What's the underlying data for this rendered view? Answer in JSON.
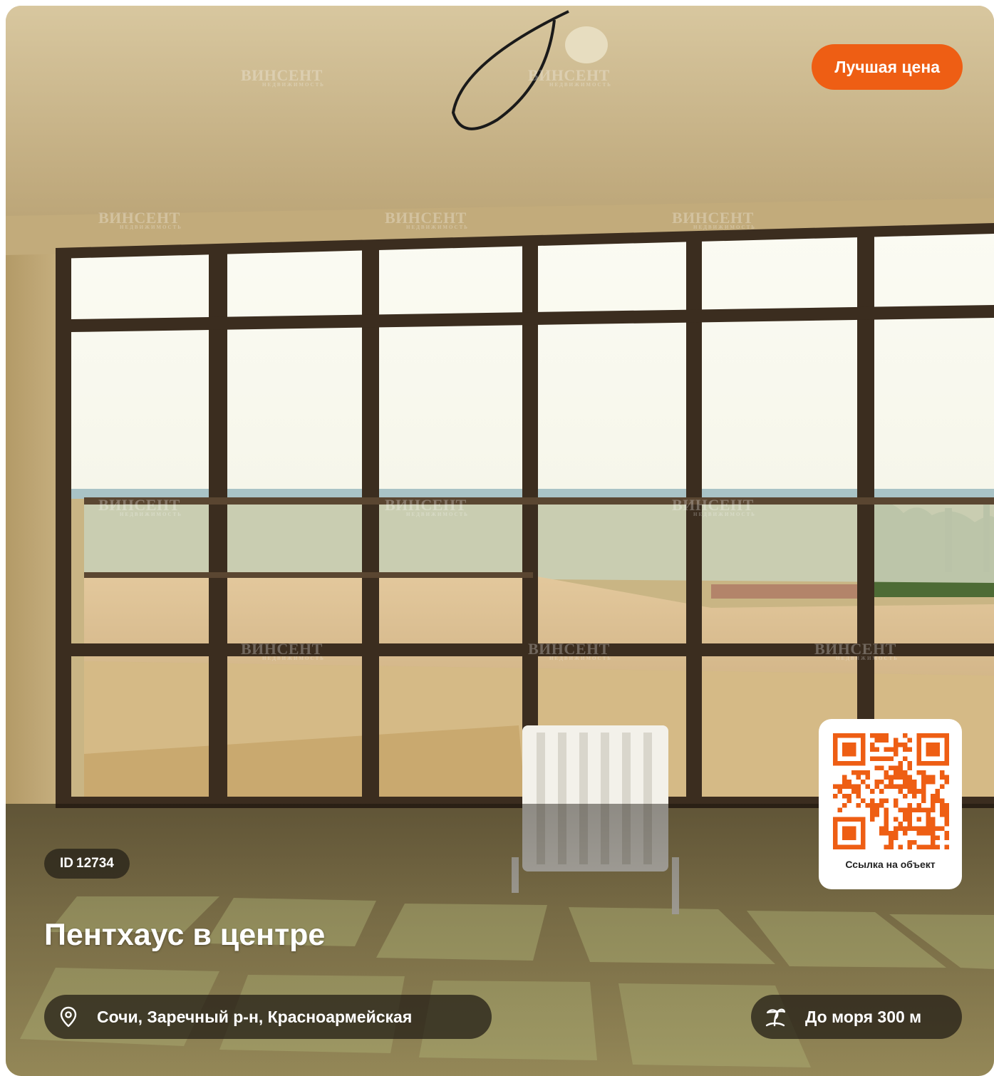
{
  "listing": {
    "badge": "Лучшая цена",
    "id_prefix": "ID",
    "id_value": "12734",
    "title": "Пентхаус в центре",
    "address": "Сочи, Заречный р-н, Красноармейская",
    "sea_distance": "До моря 300 м"
  },
  "qr": {
    "label": "Ссылка на объект"
  },
  "watermark": {
    "brand": "ВИНСЕНТ",
    "subtitle": "НЕДВИЖИМОСТЬ"
  },
  "icons": {
    "address": "map-pin-icon",
    "sea": "palm-beach-icon"
  },
  "colors": {
    "accent": "#ee5e14",
    "pill_bg": "#231e16",
    "qr_card": "#ffffff"
  }
}
